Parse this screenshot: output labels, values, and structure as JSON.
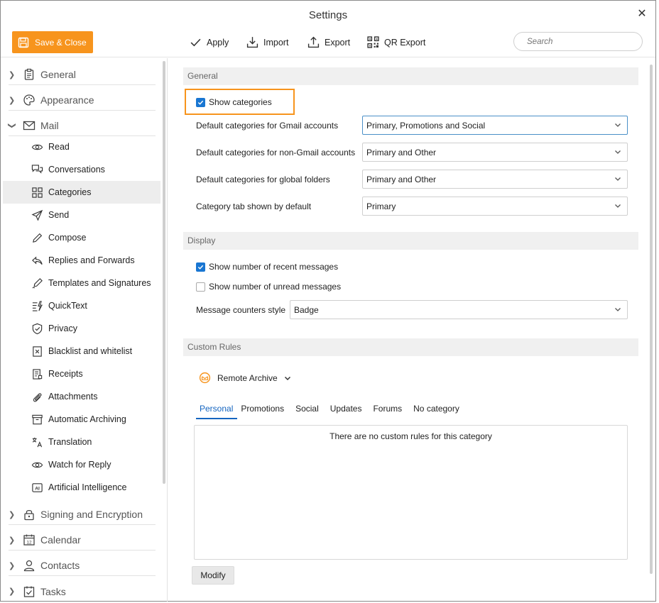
{
  "window": {
    "title": "Settings"
  },
  "toolbar": {
    "save_close": "Save & Close",
    "apply": "Apply",
    "import": "Import",
    "export": "Export",
    "qr_export": "QR Export",
    "search_placeholder": "Search"
  },
  "sidebar": {
    "groups_top": [
      {
        "label": "General",
        "icon": "clipboard-icon"
      },
      {
        "label": "Appearance",
        "icon": "palette-icon"
      },
      {
        "label": "Mail",
        "icon": "envelope-icon"
      }
    ],
    "mail_items": [
      {
        "label": "Read",
        "icon": "eye-icon"
      },
      {
        "label": "Conversations",
        "icon": "conversation-icon"
      },
      {
        "label": "Categories",
        "icon": "grid-icon",
        "active": true
      },
      {
        "label": "Send",
        "icon": "send-icon"
      },
      {
        "label": "Compose",
        "icon": "pencil-icon"
      },
      {
        "label": "Replies and Forwards",
        "icon": "reply-icon"
      },
      {
        "label": "Templates and Signatures",
        "icon": "signature-pen-icon"
      },
      {
        "label": "QuickText",
        "icon": "quicktext-icon"
      },
      {
        "label": "Privacy",
        "icon": "shield-icon"
      },
      {
        "label": "Blacklist and whitelist",
        "icon": "blacklist-icon"
      },
      {
        "label": "Receipts",
        "icon": "receipt-icon"
      },
      {
        "label": "Attachments",
        "icon": "paperclip-icon"
      },
      {
        "label": "Automatic Archiving",
        "icon": "archive-box-icon"
      },
      {
        "label": "Translation",
        "icon": "translate-icon"
      },
      {
        "label": "Watch for Reply",
        "icon": "eye-icon"
      },
      {
        "label": "Artificial Intelligence",
        "icon": "ai-icon"
      }
    ],
    "groups_bottom": [
      {
        "label": "Signing and Encryption",
        "icon": "lock-icon"
      },
      {
        "label": "Calendar",
        "icon": "calendar-icon"
      },
      {
        "label": "Contacts",
        "icon": "person-icon"
      },
      {
        "label": "Tasks",
        "icon": "task-check-icon"
      }
    ],
    "calendar_day": "12"
  },
  "general": {
    "header": "General",
    "show_categories": {
      "label": "Show categories",
      "checked": true
    },
    "rows": [
      {
        "label": "Default categories for Gmail accounts",
        "value": "Primary, Promotions and Social"
      },
      {
        "label": "Default categories for non-Gmail accounts",
        "value": "Primary and Other"
      },
      {
        "label": "Default categories for global folders",
        "value": "Primary and Other"
      },
      {
        "label": "Category tab shown by default",
        "value": "Primary"
      }
    ]
  },
  "display": {
    "header": "Display",
    "recent": {
      "label": "Show number of recent messages",
      "checked": true
    },
    "unread": {
      "label": "Show number of unread messages",
      "checked": false
    },
    "counter_label": "Message counters style",
    "counter_value": "Badge"
  },
  "custom_rules": {
    "header": "Custom Rules",
    "account": "Remote Archive",
    "tabs": [
      "Personal",
      "Promotions",
      "Social",
      "Updates",
      "Forums",
      "No category"
    ],
    "active_tab": "Personal",
    "empty_text": "There are no custom rules for this category",
    "modify": "Modify"
  },
  "colors": {
    "accent": "#f7941d",
    "blue": "#1976d2"
  }
}
